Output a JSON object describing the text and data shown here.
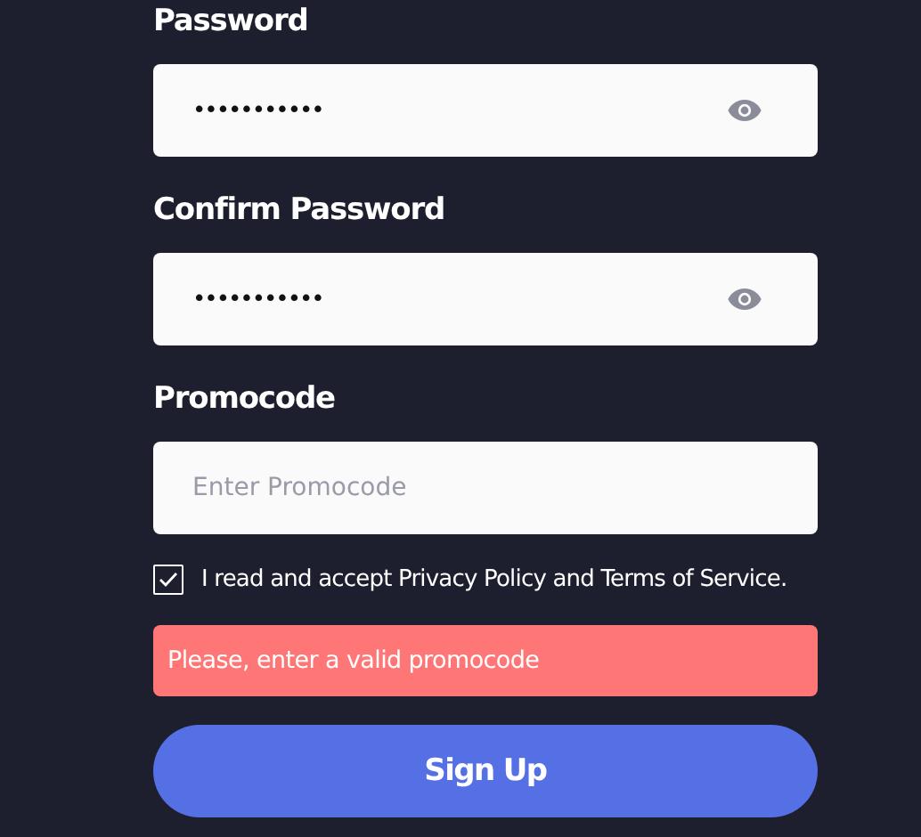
{
  "fields": [
    {
      "label": "Password",
      "kind": "password",
      "value": "•••••••••••"
    },
    {
      "label": "Confirm Password",
      "kind": "password",
      "value": "•••••••••••"
    },
    {
      "label": "Promocode",
      "kind": "text",
      "placeholder": "Enter Promocode"
    }
  ],
  "consent": {
    "checked": true,
    "text": "I read and accept Privacy Policy and Terms of Service."
  },
  "error": "Please, enter a valid promocode",
  "submit": "Sign Up"
}
